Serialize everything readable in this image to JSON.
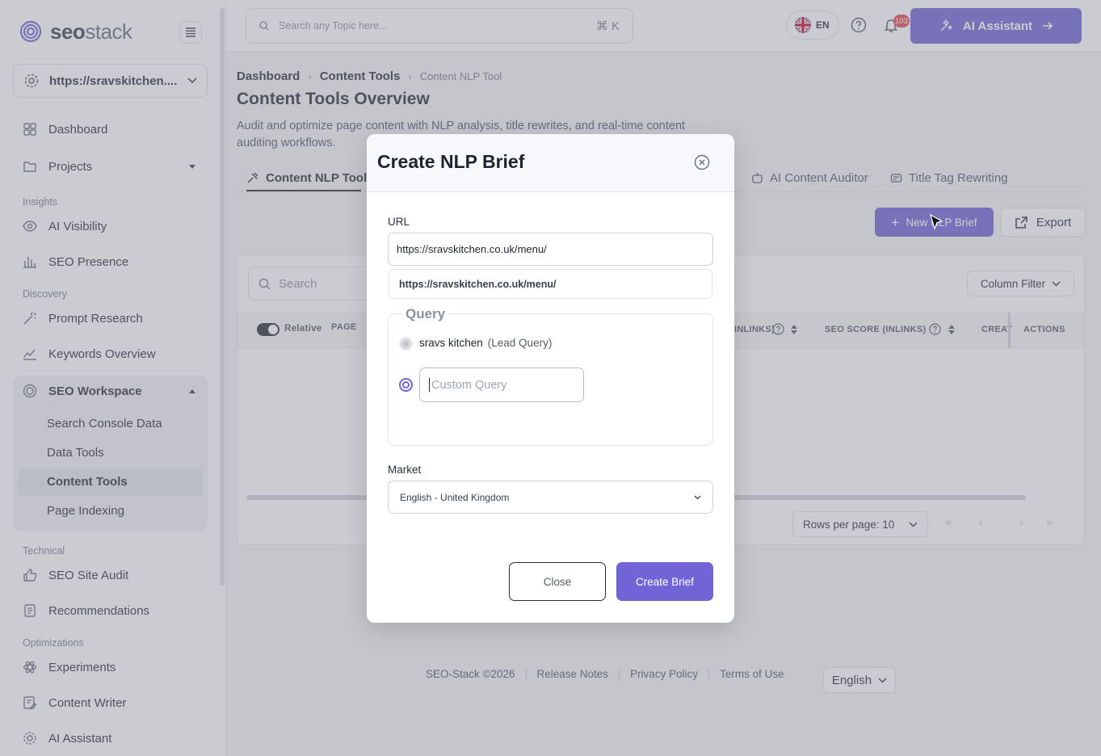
{
  "brand": {
    "name_bold": "seo",
    "name_light": "stack",
    "accent": "#7064d6"
  },
  "sidebar": {
    "site_selector": "https://sravskitchen....",
    "items": {
      "dashboard": "Dashboard",
      "projects": "Projects",
      "ai_visibility": "AI Visibility",
      "seo_presence": "SEO Presence",
      "prompt_research": "Prompt Research",
      "keywords_overview": "Keywords Overview",
      "seo_workspace": "SEO Workspace",
      "seo_site_audit": "SEO Site Audit",
      "recommendations": "Recommendations",
      "experiments": "Experiments",
      "content_writer": "Content Writer",
      "ai_assistant": "AI Assistant"
    },
    "sections": {
      "insights": "Insights",
      "discovery": "Discovery",
      "technical": "Technical",
      "optimizations": "Optimizations"
    },
    "workspace_sub": [
      "Search Console Data",
      "Data Tools",
      "Content Tools",
      "Page Indexing"
    ]
  },
  "topbar": {
    "search_placeholder": "Search any Topic here...",
    "search_shortcut": "⌘ K",
    "language": "EN",
    "notification_count": "103",
    "ai_button": "AI Assistant"
  },
  "breadcrumb": {
    "dashboard": "Dashboard",
    "content_tools": "Content Tools",
    "current": "Content NLP Tool"
  },
  "page": {
    "title": "Content Tools Overview",
    "description": "Audit and optimize page content with NLP analysis, title rewrites, and real-time content auditing workflows."
  },
  "tabs": {
    "nlp": "Content NLP Tool",
    "auditor": "AI Content Auditor",
    "title_tag": "Title Tag Rewriting"
  },
  "toolbar": {
    "new_brief": "New NLP Brief",
    "export": "Export"
  },
  "table": {
    "search_placeholder": "Search",
    "column_filter": "Column Filter",
    "relative_label": "Relative",
    "headers": {
      "page": "PAGE",
      "inlinks": "(INLINKS)",
      "seo_score": "SEO SCORE (INLINKS)",
      "created": "CREAT",
      "actions": "ACTIONS"
    },
    "rows_per_page": "Rows per page: 10"
  },
  "footer": {
    "copyright": "SEO-Stack ©2026",
    "release_notes": "Release Notes",
    "privacy": "Privacy Policy",
    "terms": "Terms of Use",
    "language": "English"
  },
  "modal": {
    "title": "Create NLP Brief",
    "url_label": "URL",
    "url_value": "https://sravskitchen.co.uk/menu/",
    "url_suggestion": "https://sravskitchen.co.uk/menu/",
    "query_legend": "Query",
    "lead_query": "sravs kitchen",
    "lead_query_tag": "(Lead Query)",
    "custom_query_placeholder": "Custom Query",
    "market_label": "Market",
    "market_value": "English - United Kingdom",
    "close_button": "Close",
    "create_button": "Create Brief"
  }
}
